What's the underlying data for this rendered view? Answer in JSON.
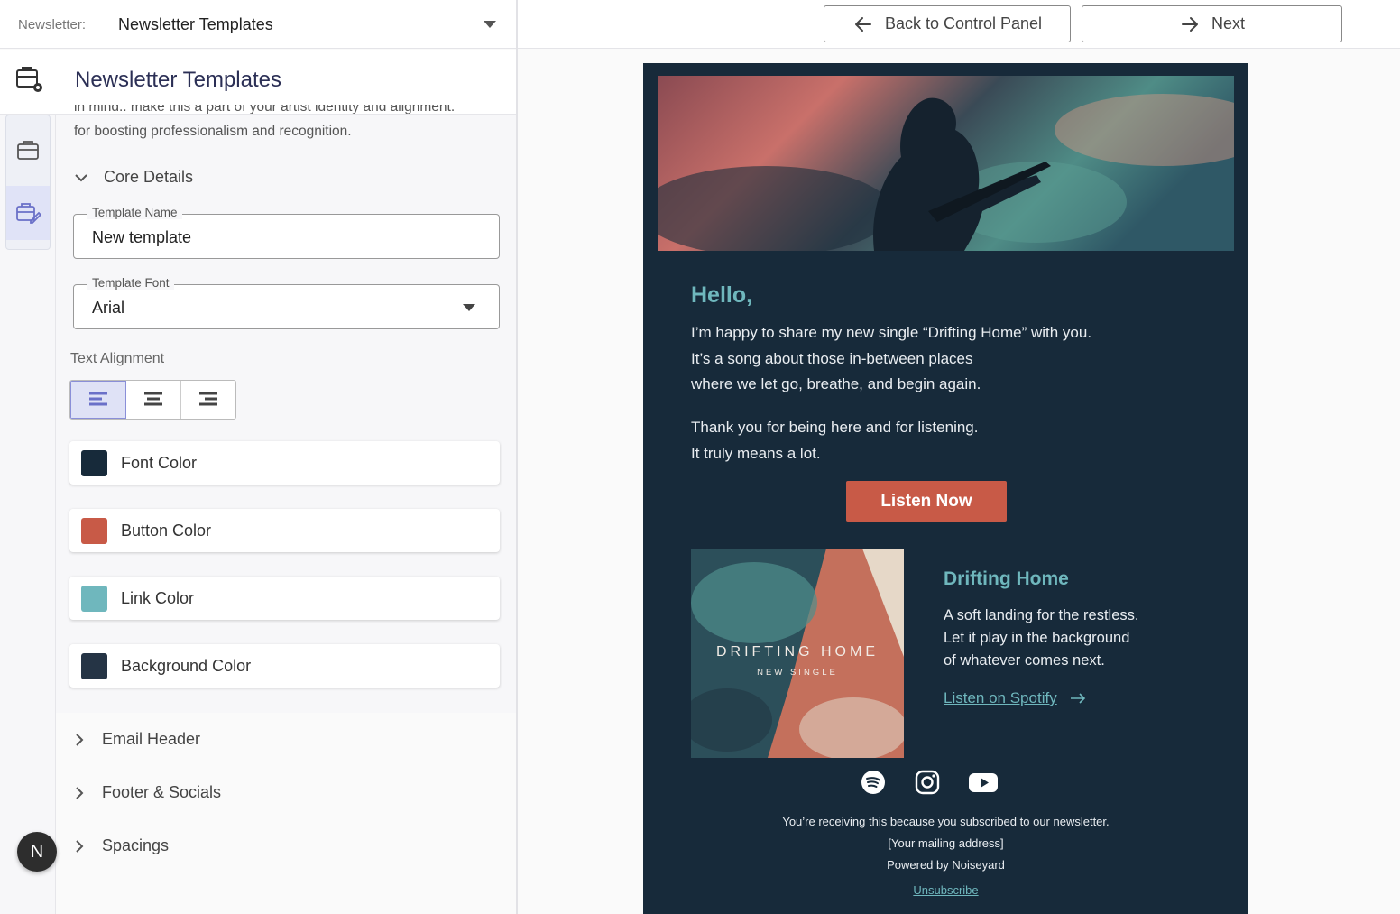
{
  "topbar": {
    "newsletter_label": "Newsletter:",
    "newsletter_value": "Newsletter Templates",
    "back_label": "Back to Control Panel",
    "next_label": "Next"
  },
  "panel": {
    "title": "Newsletter Templates",
    "description_top": "in mind.. make this a part of your artist identity and alignment.",
    "description_bottom": "for boosting professionalism and recognition.",
    "core_details": {
      "label": "Core Details",
      "template_name_label": "Template Name",
      "template_name_value": "New template",
      "template_font_label": "Template Font",
      "template_font_value": "Arial",
      "text_alignment_label": "Text Alignment"
    },
    "colors": [
      {
        "label": "Font Color",
        "color": "#172a3a"
      },
      {
        "label": "Button Color",
        "color": "#c85a47"
      },
      {
        "label": "Link Color",
        "color": "#6fb7bd"
      },
      {
        "label": "Background Color",
        "color": "#253445"
      }
    ],
    "sections": [
      "Email Header",
      "Footer & Socials",
      "Spacings"
    ]
  },
  "user": {
    "avatar_initial": "N"
  },
  "email": {
    "greeting": "Hello,",
    "para1": [
      "I’m happy to share my new single “Drifting Home” with you.",
      "It’s a song about those in-between places",
      "where we let go, breathe, and begin again."
    ],
    "para2": [
      "Thank you for being here and for listening.",
      "It truly means a lot."
    ],
    "button_label": "Listen Now",
    "album_title": "DRIFTING HOME",
    "album_subtitle": "NEW SINGLE",
    "song_title": "Drifting Home",
    "song_desc": [
      "A soft landing for the restless.",
      "Let it play in the background",
      "of whatever comes next."
    ],
    "link_label": "Listen on Spotify",
    "footer": {
      "line1": "You’re receiving this because you subscribed to our newsletter.",
      "line2": "[Your mailing address]",
      "line3": "Powered by Noiseyard",
      "unsubscribe": "Unsubscribe"
    }
  },
  "theme": {
    "accent": "#6fb7bd",
    "button": "#c85a47",
    "email_bg": "#172a3a",
    "panel_title": "#2b2f55"
  }
}
